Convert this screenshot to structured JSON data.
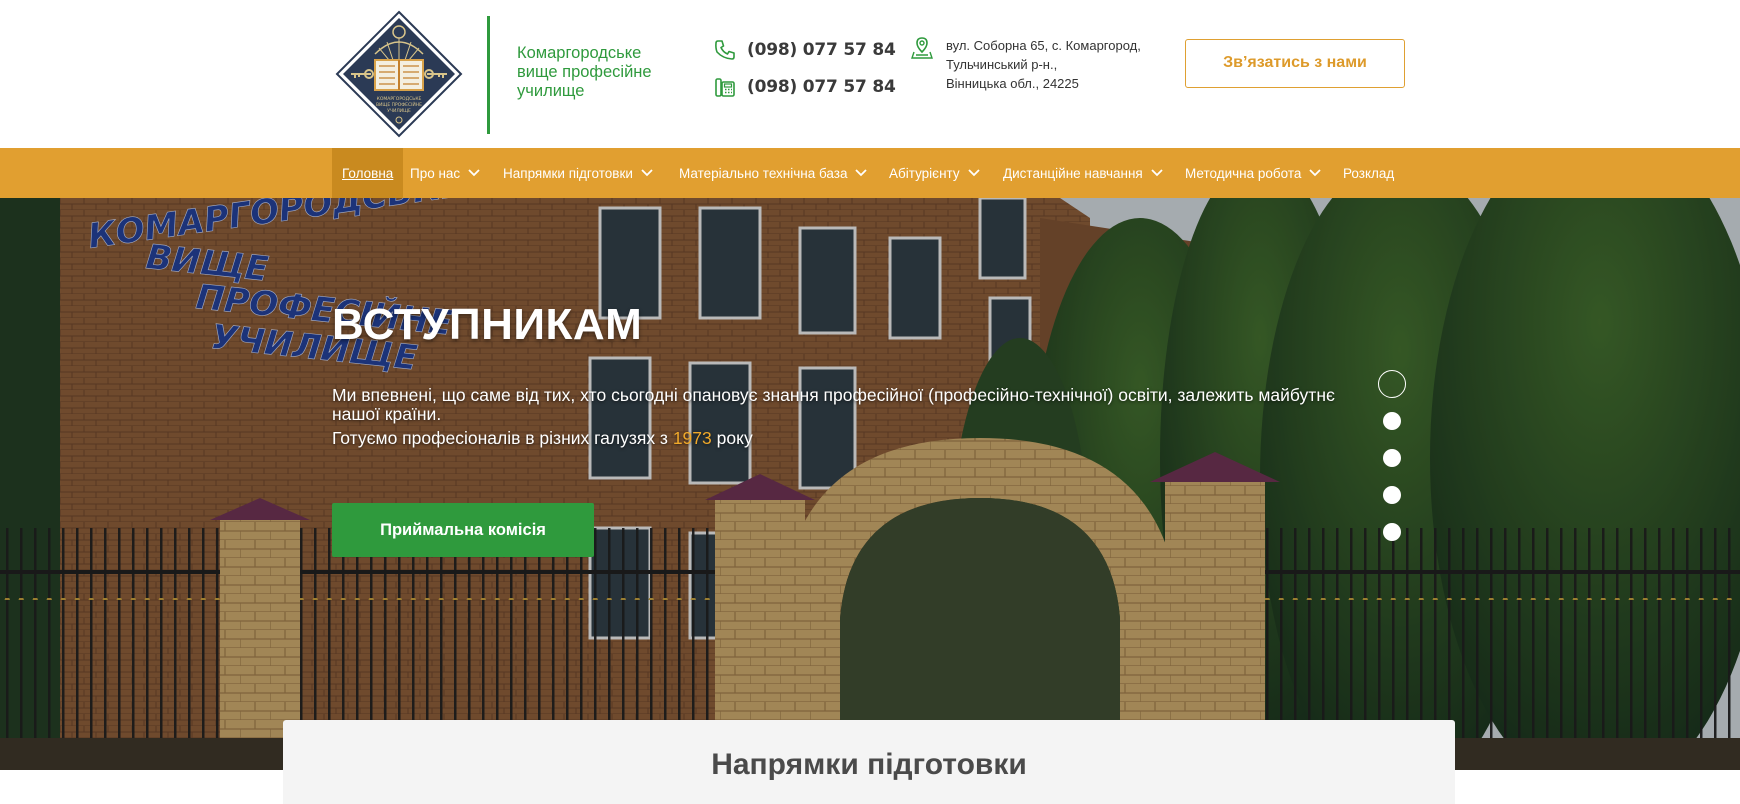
{
  "header": {
    "logo_alt": "Комаргородське вище професійне училище",
    "school_name": [
      "Комаргородське",
      "вище професійне",
      "училище"
    ],
    "phone_mobile": "(098) 077 57 84",
    "phone_landline": "(098) 077 57 84",
    "address": [
      "вул. Соборна 65, с. Комаргород,",
      "Тульчинський р-н.,",
      "Вінницька обл., 24225"
    ],
    "contact_button": "Зв’язатись з нами"
  },
  "nav": {
    "items": [
      {
        "label": "Головна",
        "dropdown": false,
        "active": true
      },
      {
        "label": "Про нас",
        "dropdown": true
      },
      {
        "label": "Напрямки підготовки",
        "dropdown": true
      },
      {
        "label": "Матеріально технічна база",
        "dropdown": true
      },
      {
        "label": "Абітурієнту",
        "dropdown": true
      },
      {
        "label": "Дистанційне навчання",
        "dropdown": true
      },
      {
        "label": "Методична робота",
        "dropdown": true
      },
      {
        "label": "Розклад",
        "dropdown": false
      }
    ]
  },
  "hero": {
    "title": "ВСТУПНИКАМ",
    "description": "Ми впевнені, що саме від тих, хто сьогодні опановує знання професійної (професійно-технічної) освіти, залежить майбутнє нашої країни.",
    "tagline_before": "Готуємо професіоналів в різних галузях з ",
    "tagline_year": "1973",
    "tagline_after": " року",
    "button": "Приймальна комісія",
    "slides_total": 5,
    "active_slide": 1,
    "building_sign": [
      "КОМАРГОРОДСЬКЕ",
      "ВИЩЕ",
      "ПРОФЕСІЙНЕ",
      "УЧИЛИЩЕ"
    ]
  },
  "section": {
    "title": "Напрямки підготовки"
  },
  "colors": {
    "green": "#2f9a3d",
    "orange": "#e19f30",
    "orange_dark": "#c98a1f"
  }
}
